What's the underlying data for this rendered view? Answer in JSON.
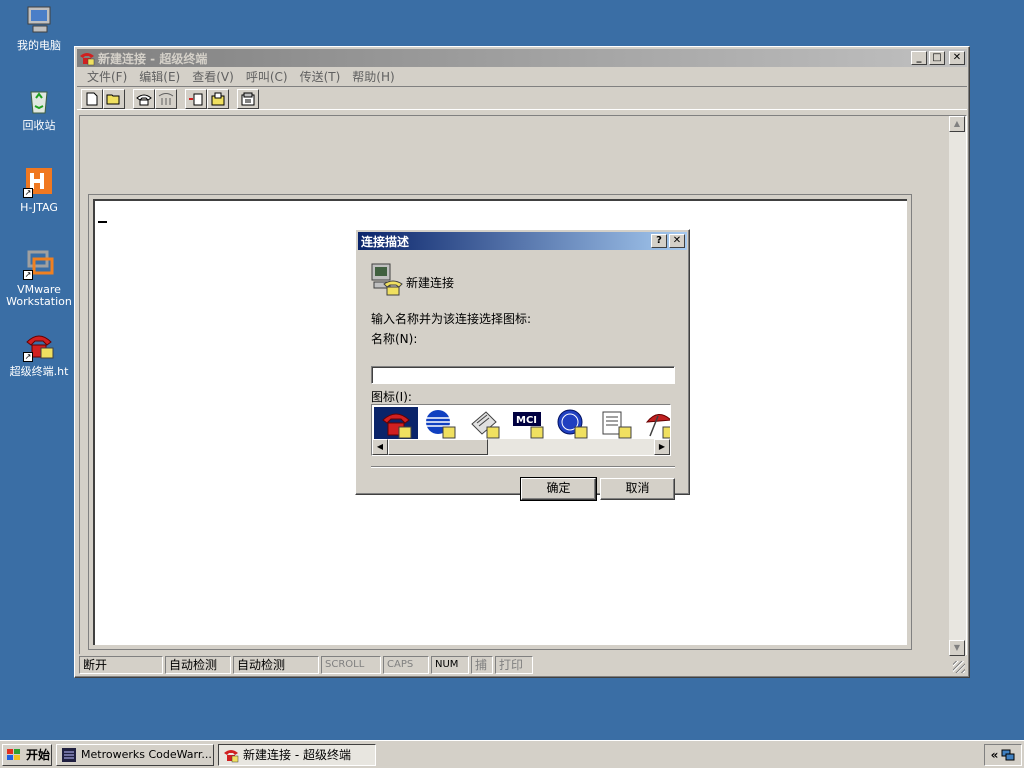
{
  "desktop": {
    "icons": [
      {
        "label": "我的电脑",
        "icon": "my-computer-icon"
      },
      {
        "label": "回收站",
        "icon": "recycle-bin-icon"
      },
      {
        "label": "H-JTAG",
        "icon": "h-jtag-icon"
      },
      {
        "label": "VMware Workstation",
        "icon": "vmware-icon"
      },
      {
        "label": "超级终端.ht",
        "icon": "hyperterminal-icon"
      }
    ]
  },
  "main_window": {
    "title": "新建连接 - 超级终端",
    "menu": [
      "文件(F)",
      "编辑(E)",
      "查看(V)",
      "呼叫(C)",
      "传送(T)",
      "帮助(H)"
    ],
    "toolbar": [
      "new-icon",
      "open-icon",
      "call-icon",
      "disconnect-icon",
      "send-icon",
      "receive-icon",
      "properties-icon"
    ],
    "status": [
      "断开",
      "自动检测",
      "自动检测",
      "SCROLL",
      "CAPS",
      "NUM",
      "捕",
      "打印"
    ]
  },
  "dialog": {
    "title": "连接描述",
    "connection_name": "新建连接",
    "instruction": "输入名称并为该连接选择图标:",
    "name_label": "名称(N):",
    "name_value": "",
    "icon_label": "图标(I):",
    "icons": [
      "red-phone-icon",
      "globe-phone-icon",
      "fax-phone-icon",
      "mci-phone-icon",
      "ge-phone-icon",
      "document-phone-icon",
      "umbrella-phone-icon"
    ],
    "ok_label": "确定",
    "cancel_label": "取消"
  },
  "taskbar": {
    "start_label": "开始",
    "tasks": [
      "Metrowerks CodeWarr...",
      "新建连接 - 超级终端"
    ],
    "tray_label": "«"
  },
  "colors": {
    "desktop": "#3a6ea5",
    "active_title": "#0a246a",
    "face": "#d4d0c8"
  }
}
